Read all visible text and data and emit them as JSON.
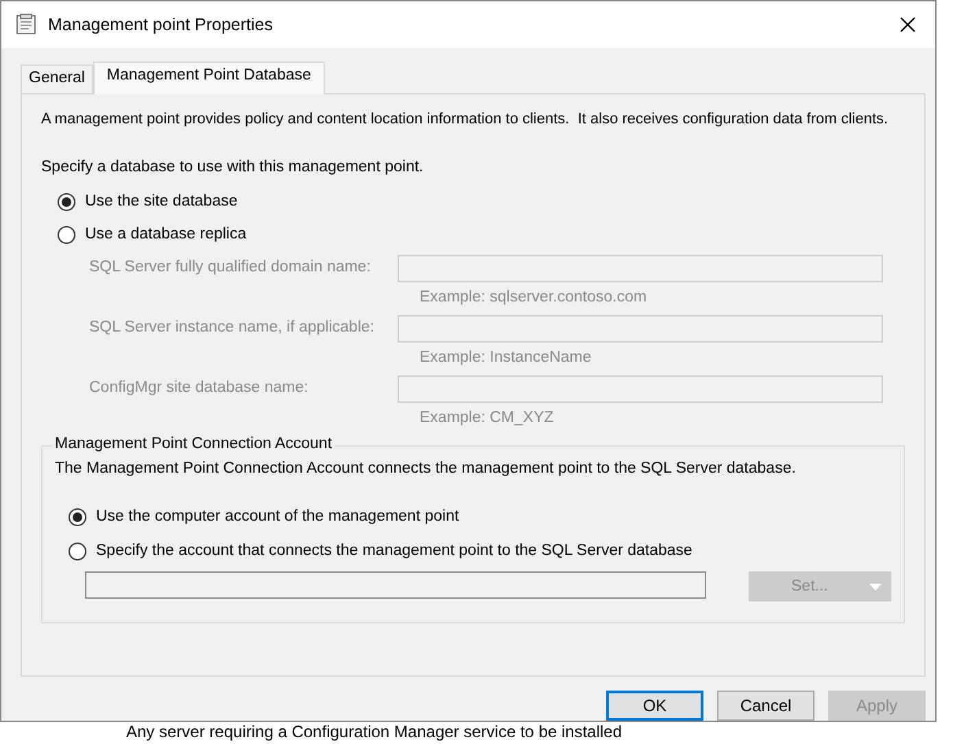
{
  "window": {
    "title": "Management point Properties"
  },
  "tabs": [
    {
      "label": "General",
      "selected": false
    },
    {
      "label": "Management Point Database",
      "selected": true
    }
  ],
  "description": "A management point provides policy and content location information to clients.  It also receives configuration data from clients.",
  "database": {
    "prompt": "Specify a database to use with this management point.",
    "options": [
      {
        "label": "Use the site database",
        "selected": true
      },
      {
        "label": "Use a database replica",
        "selected": false
      }
    ],
    "fields": [
      {
        "label": "SQL Server fully qualified domain name:",
        "example": "Example: sqlserver.contoso.com",
        "disabled": true
      },
      {
        "label": "SQL Server instance name, if applicable:",
        "example": "Example: InstanceName",
        "disabled": true
      },
      {
        "label": "ConfigMgr site database name:",
        "example": "Example: CM_XYZ",
        "disabled": true
      }
    ]
  },
  "connection_account": {
    "title": "Management Point Connection Account",
    "description": "The Management Point Connection Account connects the management point to the SQL Server database.",
    "options": [
      {
        "label": "Use the computer account of the management point",
        "selected": true
      },
      {
        "label": "Specify the account that connects the management point to the SQL Server database",
        "selected": false
      }
    ],
    "account_field": {
      "disabled": true
    },
    "set_button": {
      "label": "Set...",
      "disabled": true
    }
  },
  "buttons": [
    {
      "label": "OK",
      "default": true,
      "disabled": false
    },
    {
      "label": "Cancel",
      "default": false,
      "disabled": false
    },
    {
      "label": "Apply",
      "default": false,
      "disabled": true
    }
  ],
  "background_text": "Any server requiring a Configuration Manager service to be installed"
}
